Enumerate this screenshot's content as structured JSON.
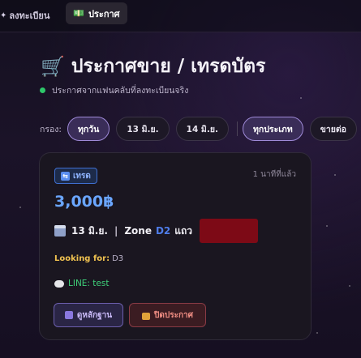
{
  "topbar": {
    "tabs": [
      {
        "label": "ลงทะเบียน",
        "icon": "sparkle-icon"
      },
      {
        "label": "ประกาศ",
        "icon": "cash-icon"
      }
    ]
  },
  "header": {
    "title": "ประกาศขาย / เทรดบัตร",
    "title_icon": "cart-icon",
    "subtitle": "ประกาศจากแฟนคลับที่ลงทะเบียนจริง"
  },
  "filters": {
    "label": "กรอง:",
    "chips": [
      "ทุกวัน",
      "13 มิ.ย.",
      "14 มิ.ย.",
      "ทุกประเภท",
      "ขายต่อ"
    ],
    "active": [
      0,
      3
    ]
  },
  "listing": {
    "badge": "เทรด",
    "time": "1 นาทีที่แล้ว",
    "price": "3,000฿",
    "date": "13 มิ.ย.",
    "separator": "|",
    "zone_label": "Zone",
    "zone_value": "D2",
    "row_label": "แถว",
    "looking_label": "Looking for:",
    "looking_value": "D3",
    "contact": "LINE: test",
    "buttons": {
      "proof": "ดูหลักฐาน",
      "close": "ปิดประกาศ"
    }
  },
  "colors": {
    "accent": "#9f8ad8",
    "price": "#6aa6ff",
    "online": "#2ec76a",
    "line": "#3fd17a",
    "looking": "#f0c250",
    "danger": "#f18e84"
  }
}
